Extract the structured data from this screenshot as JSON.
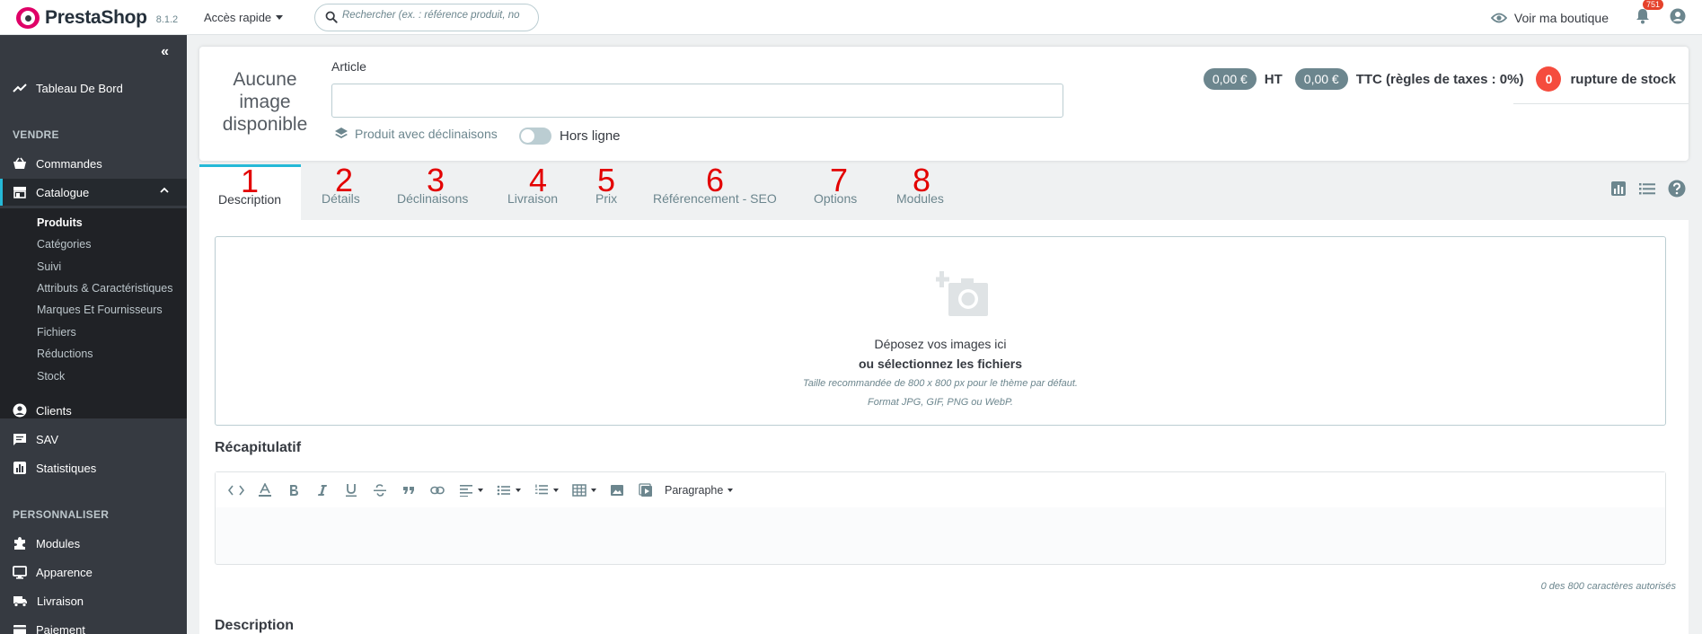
{
  "topbar": {
    "brand": "PrestaShop",
    "version": "8.1.2",
    "quick_access": "Accès rapide",
    "search_placeholder": "Rechercher (ex. : référence produit, no",
    "view_shop": "Voir ma boutique",
    "notifications_count": "751"
  },
  "sidebar": {
    "collapse_label": "«",
    "dashboard": "Tableau De Bord",
    "section_sell": "VENDRE",
    "orders": "Commandes",
    "catalog": "Catalogue",
    "catalog_sub": [
      "Produits",
      "Catégories",
      "Suivi",
      "Attributs & Caractéristiques",
      "Marques Et Fournisseurs",
      "Fichiers",
      "Réductions",
      "Stock"
    ],
    "customers": "Clients",
    "sav": "SAV",
    "stats": "Statistiques",
    "section_customize": "PERSONNALISER",
    "modules": "Modules",
    "appearance": "Apparence",
    "shipping": "Livraison",
    "payment": "Paiement"
  },
  "header": {
    "no_image": "Aucune image disponible",
    "article_label": "Article",
    "article_value": "",
    "with_combinations": "Produit avec déclinaisons",
    "offline_label": "Hors ligne",
    "price_ht": "0,00 €",
    "ht_label": "HT",
    "price_ttc": "0,00 €",
    "ttc_label": "TTC (règles de taxes : 0%)",
    "stock_count": "0",
    "stock_label": "rupture de stock"
  },
  "tabs": [
    {
      "num": "1",
      "label": "Description"
    },
    {
      "num": "2",
      "label": "Détails"
    },
    {
      "num": "3",
      "label": "Déclinaisons"
    },
    {
      "num": "4",
      "label": "Livraison"
    },
    {
      "num": "5",
      "label": "Prix"
    },
    {
      "num": "6",
      "label": "Référencement - SEO"
    },
    {
      "num": "7",
      "label": "Options"
    },
    {
      "num": "8",
      "label": "Modules"
    }
  ],
  "dropzone": {
    "line1": "Déposez vos images ici",
    "line2": "ou sélectionnez les fichiers",
    "line3": "Taille recommandée de 800 x 800 px pour le thème par défaut.",
    "line4": "Format JPG, GIF, PNG ou WebP."
  },
  "summary": {
    "title": "Récapitulatif",
    "paragraph": "Paragraphe",
    "char_count": "0 des 800 caractères autorisés"
  },
  "description": {
    "title": "Description"
  },
  "colors": {
    "accent": "#25b9d7",
    "sidebar_bg": "#363a41",
    "danger": "#f54c3e",
    "annotation_red": "#e30000"
  }
}
